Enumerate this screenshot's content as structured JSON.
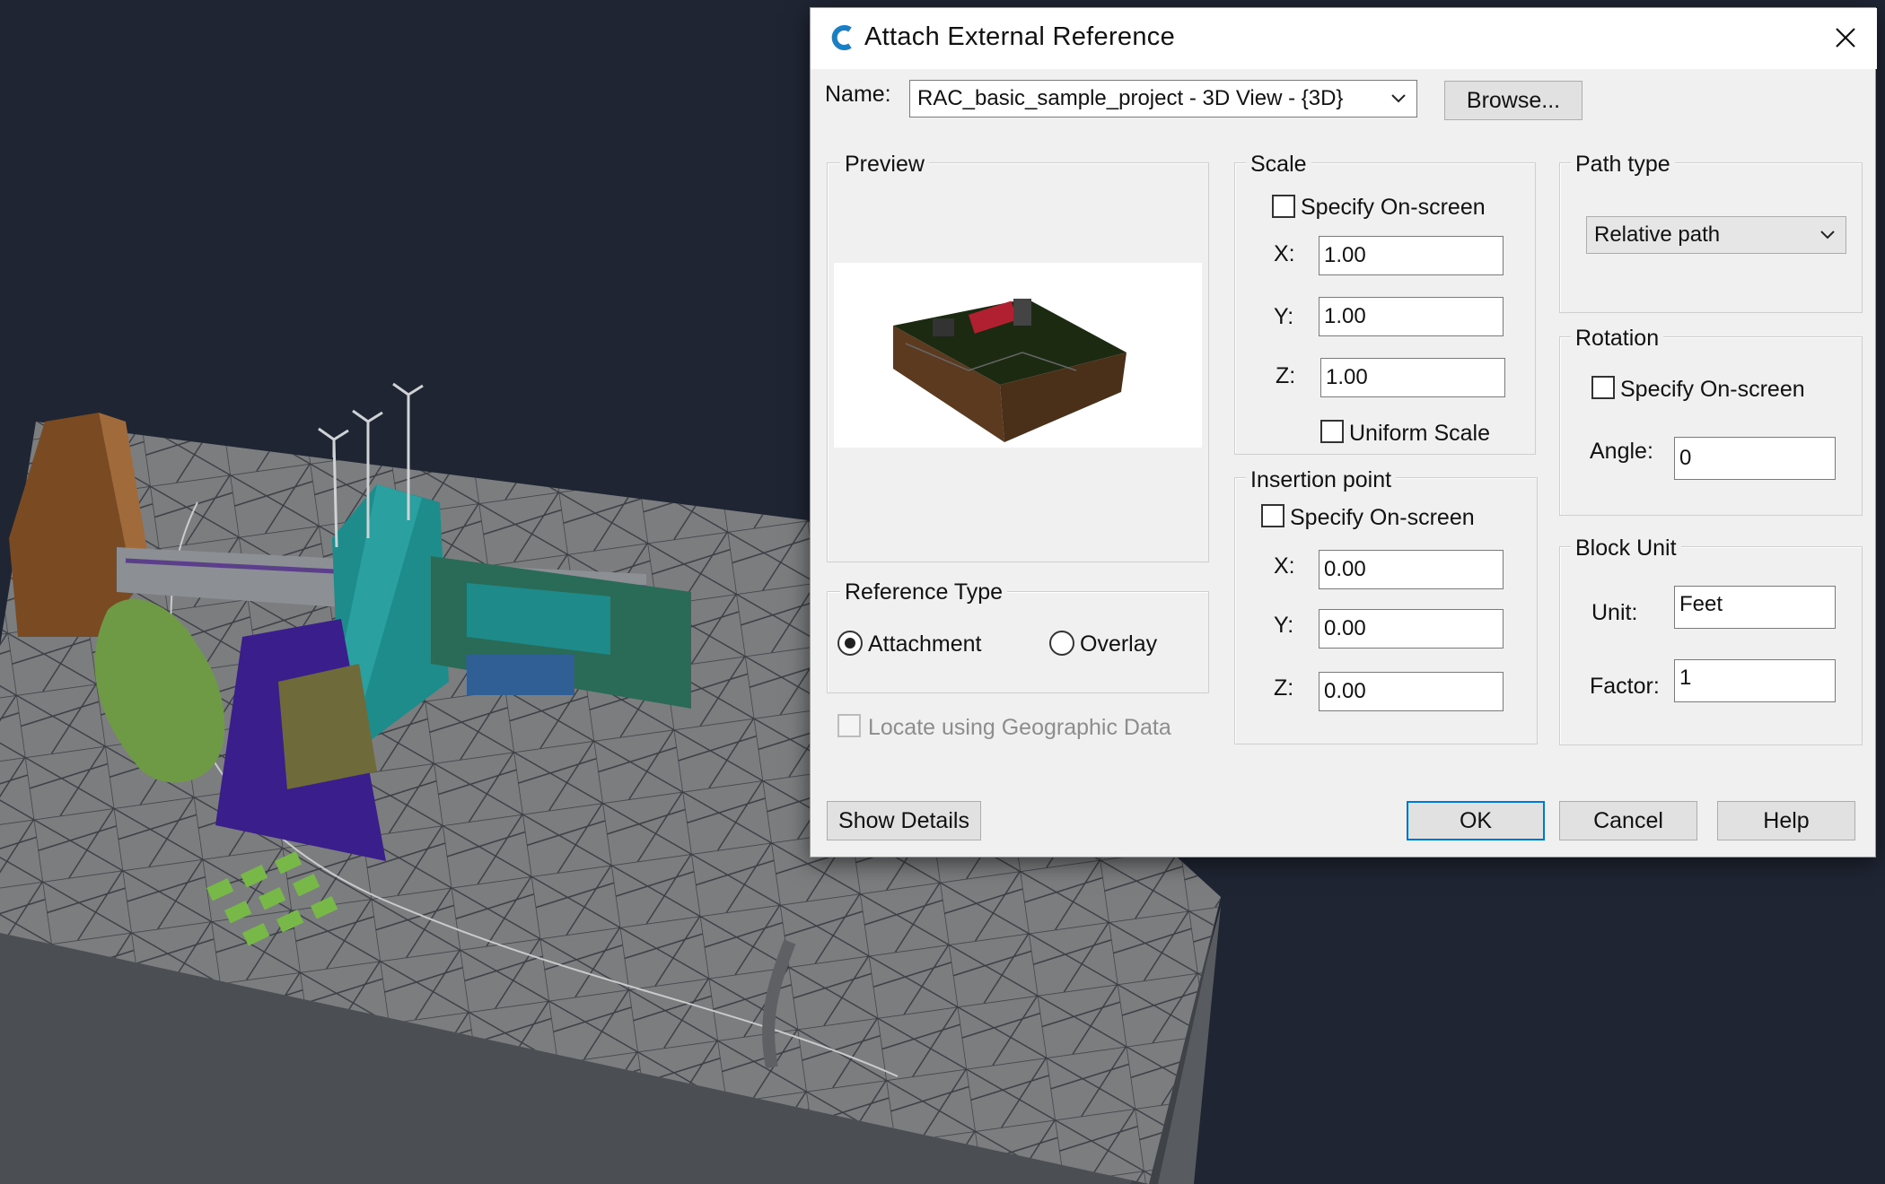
{
  "dialog": {
    "title": "Attach External Reference",
    "name_label": "Name:",
    "name_value": "RAC_basic_sample_project - 3D View - {3D}",
    "browse_label": "Browse...",
    "preview_title": "Preview",
    "scale": {
      "title": "Scale",
      "specify_onscreen": "Specify On-screen",
      "x_label": "X:",
      "x_value": "1.00",
      "y_label": "Y:",
      "y_value": "1.00",
      "z_label": "Z:",
      "z_value": "1.00",
      "uniform_scale": "Uniform Scale"
    },
    "insertion": {
      "title": "Insertion point",
      "specify_onscreen": "Specify On-screen",
      "x_label": "X:",
      "x_value": "0.00",
      "y_label": "Y:",
      "y_value": "0.00",
      "z_label": "Z:",
      "z_value": "0.00"
    },
    "path_type": {
      "title": "Path type",
      "value": "Relative path"
    },
    "rotation": {
      "title": "Rotation",
      "specify_onscreen": "Specify On-screen",
      "angle_label": "Angle:",
      "angle_value": "0"
    },
    "block_unit": {
      "title": "Block Unit",
      "unit_label": "Unit:",
      "unit_value": "Feet",
      "factor_label": "Factor:",
      "factor_value": "1"
    },
    "reference_type": {
      "title": "Reference Type",
      "attachment": "Attachment",
      "overlay": "Overlay",
      "selected": "Attachment"
    },
    "locate_geo": "Locate using Geographic Data",
    "show_details": "Show Details",
    "ok": "OK",
    "cancel": "Cancel",
    "help": "Help"
  },
  "icons": {
    "app": "autocad-c-icon",
    "close": "close-icon",
    "dropdown": "chevron-down-icon"
  },
  "colors": {
    "viewport_bg": "#1f2533",
    "dialog_bg": "#f0f0f0",
    "accent": "#0078d7",
    "app_icon": "#1b7fc4"
  }
}
